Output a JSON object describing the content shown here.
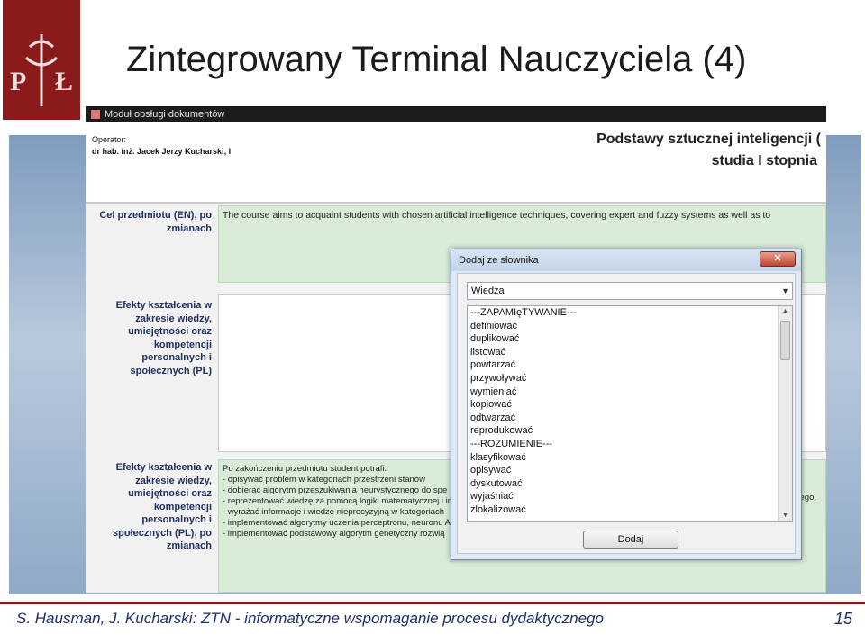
{
  "slide": {
    "title": "Zintegrowany Terminal Nauczyciela (4)",
    "footer": "S. Hausman, J. Kucharski: ZTN - informatyczne wspomaganie procesu dydaktycznego",
    "page_number": "15",
    "logo_text": "P Ł"
  },
  "app": {
    "window_title": "Moduł obsługi dokumentów",
    "operator_label": "Operator:",
    "operator_name": "dr hab. inż. Jacek Jerzy Kucharski, I",
    "course_title": "Podstawy sztucznej inteligencji (",
    "course_level": "studia I stopnia"
  },
  "fields": {
    "goal_label": "Cel przedmiotu (EN), po zmianach",
    "goal_value": "The course aims to acquaint students with chosen artificial intelligence techniques, covering expert and fuzzy systems as well as to",
    "outcomes_label": "Efekty kształcenia w zakresie wiedzy, umiejętności oraz kompetencji personalnych i społecznych (PL)",
    "outcomes_changed_label": "Efekty kształcenia w zakresie wiedzy, umiejętności oraz kompetencji personalnych i społecznych (PL), po zmianach",
    "outcomes_changed_lines": [
      "Po zakończeniu przedmiotu student potrafi:",
      "- opisywać problem w kategoriach przestrzeni stanów",
      "- dobierać algorytm przeszukiwania heurystycznego do spe",
      "- reprezentować wiedzę za pomocą logiki matematycznej i in",
      "- wyrażać informacje i wiedzę nieprecyzyjną w kategoriach",
      "- implementować algorytmy uczenia perceptronu, neuronu A",
      "- implementować podstawowy algorytm genetyczny rozwią"
    ],
    "right_fragment": "ego,"
  },
  "dialog": {
    "title": "Dodaj ze słownika",
    "close_glyph": "✕",
    "select_value": "Wiedza",
    "items": [
      "---ZAPAMIęTYWANIE---",
      "definiować",
      "duplikować",
      "listować",
      "powtarzać",
      "przywoływać",
      "wymieniać",
      "kopiować",
      "odtwarzać",
      "reprodukować",
      "---ROZUMIENIE---",
      "klasyfikować",
      "opisywać",
      "dyskutować",
      "wyjaśniać",
      "zlokalizować"
    ],
    "add_button": "Dodaj"
  },
  "colors": {
    "brand": "#8b1a1a",
    "field_bg": "#d8ecd8",
    "footer_text": "#1f2d6a"
  }
}
